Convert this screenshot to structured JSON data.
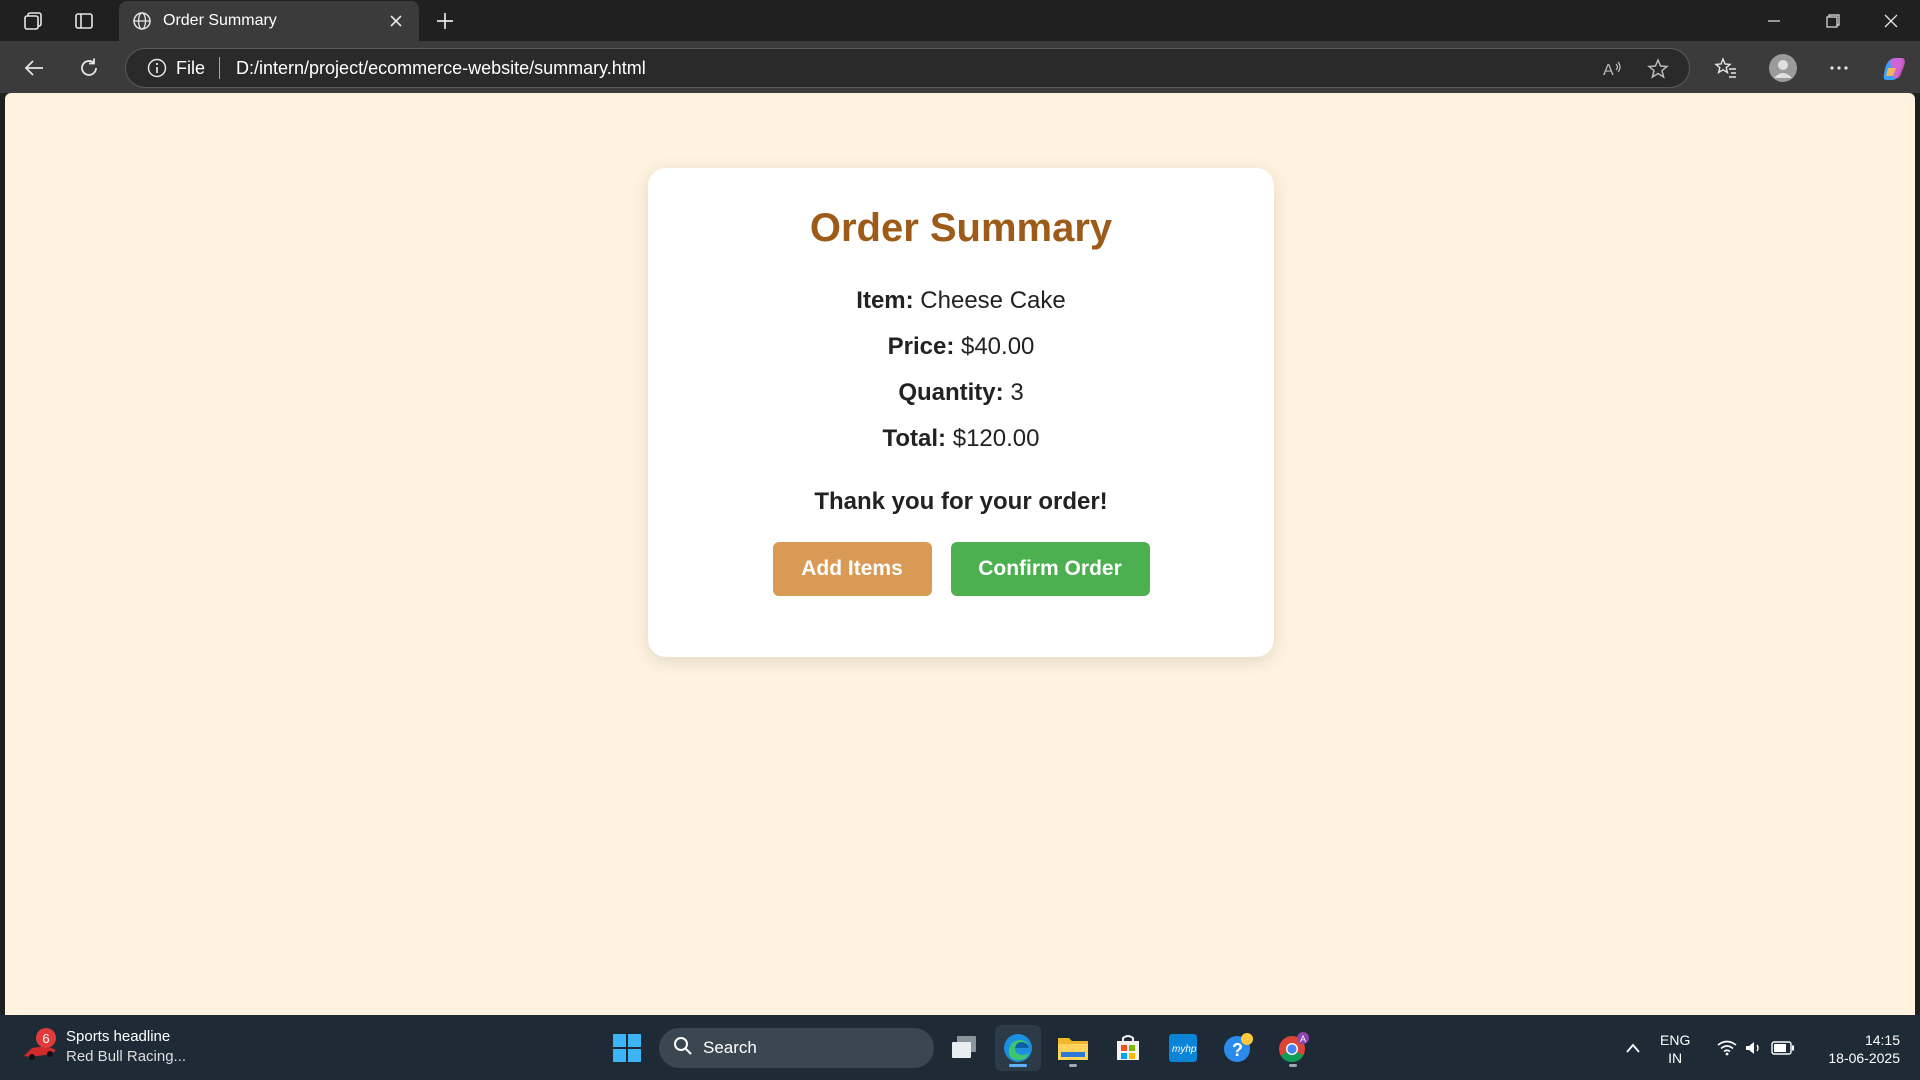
{
  "browser": {
    "tab_title": "Order Summary",
    "address_prefix": "File",
    "url": "D:/intern/project/ecommerce-website/summary.html"
  },
  "order": {
    "heading": "Order Summary",
    "item_label": "Item:",
    "item_value": "Cheese Cake",
    "price_label": "Price:",
    "price_value": "$40.00",
    "quantity_label": "Quantity:",
    "quantity_value": "3",
    "total_label": "Total:",
    "total_value": "$120.00",
    "thanks": "Thank you for your order!",
    "add_button": "Add Items",
    "confirm_button": "Confirm Order"
  },
  "taskbar": {
    "news_badge": "6",
    "news_title": "Sports headline",
    "news_sub": "Red Bull Racing...",
    "search_placeholder": "Search",
    "lang_line1": "ENG",
    "lang_line2": "IN",
    "time": "14:15",
    "date": "18-06-2025"
  },
  "colors": {
    "page_bg": "#fff3e0",
    "heading": "#9c5b18",
    "add_button": "#d89a55",
    "confirm_button": "#4caf50"
  }
}
